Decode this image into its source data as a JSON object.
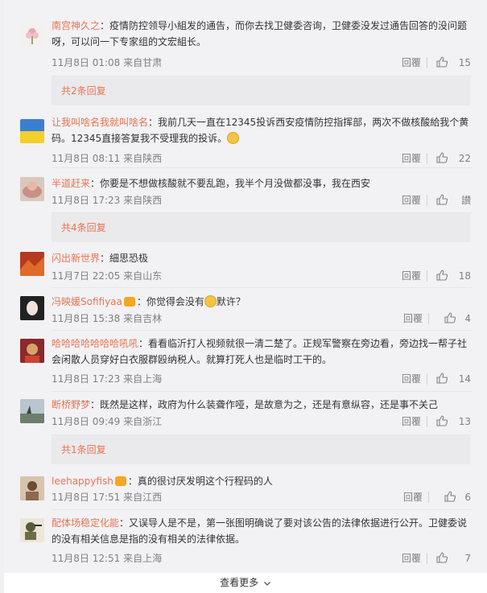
{
  "ui": {
    "reply_label": "回覆",
    "see_more": "查看更多",
    "see_more_icon": "chevron-down-icon",
    "accent_color": "#eb7350"
  },
  "comments": [
    {
      "user": "南宫神久之",
      "text": "：疫情防控领导小組发的通告，而你去找卫健委咨询，卫健委没发过通告回答的没问题呀，可以问一下专家组的文宏組长。",
      "time": "11月8日 01:08 来自甘肃",
      "likes": "15"
    },
    {
      "user": "让我叫啥名我就叫啥名",
      "text": "：我前几天一直在12345投诉西安疫情防控指挥部，两次不做核酸給我个黄码。12345直接答复我不受理我的投诉。",
      "time": "11月8日 08:11 来自陕西",
      "likes": "22"
    },
    {
      "user": "半道赶来",
      "text": "：你要是不想做核酸就不要乱跑，我半个月没做都没事，我在西安",
      "time": "11月8日 17:23 来自陕西",
      "likes": "讃"
    },
    {
      "user": "闪出新世界",
      "text": "：細思恐极",
      "time": "11月7日 22:05 来自山东",
      "likes": "18"
    },
    {
      "user": "冯映媛Sofifiyaa",
      "text": "：你觉得会没有",
      "text2": "默许？",
      "time": "11月8日 15:38 来自吉林",
      "likes": "4"
    },
    {
      "user": "哈哈哈哈哈哈哈吼吼",
      "text": "：看看临沂打人视频就很一清二楚了。正规军警察在旁边看，旁边找一帮子社会闲散人员穿好白衣服群殴纳税人。就算打死人也是临时工干的。",
      "time": "11月8日 17:23 来自上海",
      "likes": "14"
    },
    {
      "user": "断桥野梦",
      "text": "：既然是这样，政府为什么装聋作哑，是故意为之，还是有意纵容，还是事不关己",
      "time": "11月8日 09:49 来自浙江",
      "likes": "13"
    },
    {
      "user": "leehappyfish",
      "text": "：真的很讨厌发明这个行程码的人",
      "time": "11月8日 17:51 来自江西",
      "likes": "6"
    },
    {
      "user": "配体场稳定化能",
      "text": "：又误导人是不是，第一张图明确说了要对该公告的法律依据进行公开。卫健委说的没有相关信息是指的没有相关的法律依据。",
      "time": "11月8日 12:51 来自上海",
      "likes": "7"
    }
  ],
  "reply_bars": [
    {
      "label": "共2条回复"
    },
    {
      "label": "共4条回复"
    },
    {
      "label": "共1条回复"
    }
  ]
}
